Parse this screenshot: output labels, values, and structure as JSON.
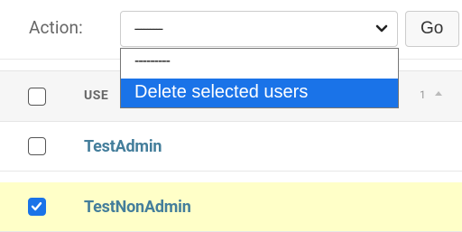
{
  "actions": {
    "label": "Action:",
    "selected_value": "---------",
    "go_label": "Go",
    "options": [
      "---------",
      "Delete selected users"
    ],
    "highlighted_option": "Delete selected users"
  },
  "table": {
    "header": {
      "username_column": "USE",
      "sort_priority": "1",
      "sort_direction": "ascending"
    },
    "rows": [
      {
        "username": "TestAdmin",
        "selected": false
      },
      {
        "username": "TestNonAdmin",
        "selected": true
      }
    ]
  },
  "colors": {
    "link": "#447e9b",
    "selected_row": "#ffffc8",
    "accent": "#1a73e8"
  }
}
